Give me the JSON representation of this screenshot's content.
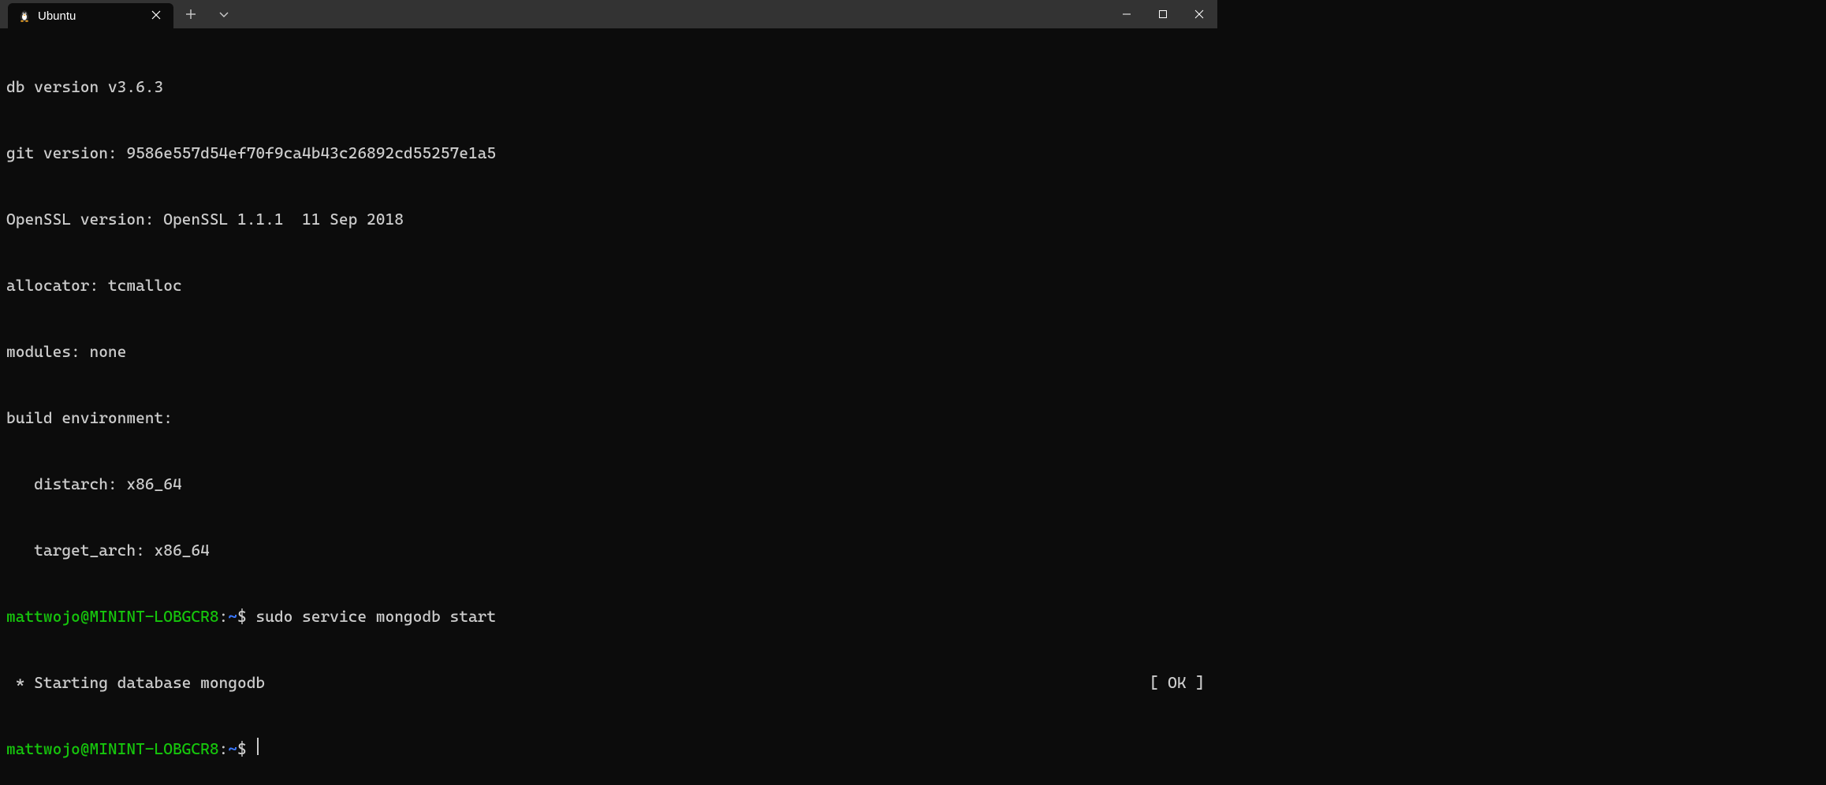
{
  "titlebar": {
    "tab": {
      "title": "Ubuntu"
    }
  },
  "terminal": {
    "lines": {
      "db_version": "db version v3.6.3",
      "git_version": "git version: 9586e557d54ef70f9ca4b43c26892cd55257e1a5",
      "openssl": "OpenSSL version: OpenSSL 1.1.1  11 Sep 2018",
      "allocator": "allocator: tcmalloc",
      "modules": "modules: none",
      "build_env": "build environment:",
      "distarch": "distarch: x86_64",
      "target_arch": "target_arch: x86_64"
    },
    "prompt1": {
      "user_host": "mattwojo@MININT-LOBGCR8",
      "colon": ":",
      "path": "~",
      "dollar": "$ ",
      "command": "sudo service mongodb start"
    },
    "status": {
      "left": " * Starting database mongodb",
      "right": "[ OK ]"
    },
    "prompt2": {
      "user_host": "mattwojo@MININT-LOBGCR8",
      "colon": ":",
      "path": "~",
      "dollar": "$ "
    }
  }
}
